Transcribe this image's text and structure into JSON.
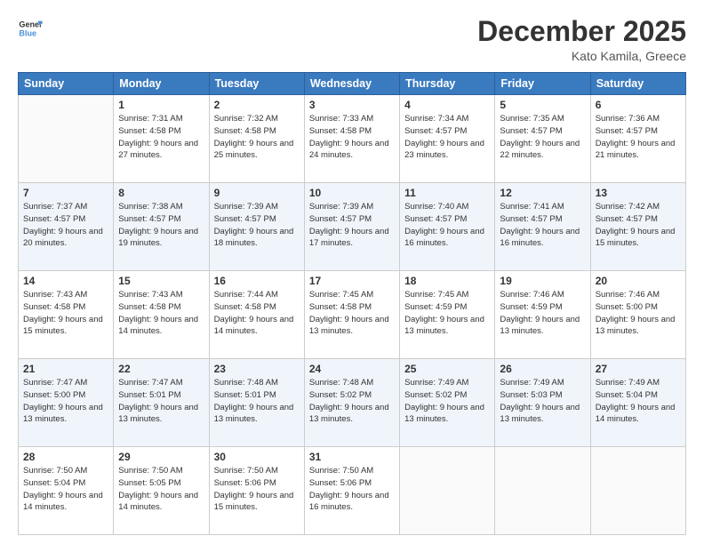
{
  "header": {
    "logo_line1": "General",
    "logo_line2": "Blue",
    "month": "December 2025",
    "location": "Kato Kamila, Greece"
  },
  "weekdays": [
    "Sunday",
    "Monday",
    "Tuesday",
    "Wednesday",
    "Thursday",
    "Friday",
    "Saturday"
  ],
  "weeks": [
    [
      {
        "day": "",
        "sunrise": "",
        "sunset": "",
        "daylight": ""
      },
      {
        "day": "1",
        "sunrise": "Sunrise: 7:31 AM",
        "sunset": "Sunset: 4:58 PM",
        "daylight": "Daylight: 9 hours and 27 minutes."
      },
      {
        "day": "2",
        "sunrise": "Sunrise: 7:32 AM",
        "sunset": "Sunset: 4:58 PM",
        "daylight": "Daylight: 9 hours and 25 minutes."
      },
      {
        "day": "3",
        "sunrise": "Sunrise: 7:33 AM",
        "sunset": "Sunset: 4:58 PM",
        "daylight": "Daylight: 9 hours and 24 minutes."
      },
      {
        "day": "4",
        "sunrise": "Sunrise: 7:34 AM",
        "sunset": "Sunset: 4:57 PM",
        "daylight": "Daylight: 9 hours and 23 minutes."
      },
      {
        "day": "5",
        "sunrise": "Sunrise: 7:35 AM",
        "sunset": "Sunset: 4:57 PM",
        "daylight": "Daylight: 9 hours and 22 minutes."
      },
      {
        "day": "6",
        "sunrise": "Sunrise: 7:36 AM",
        "sunset": "Sunset: 4:57 PM",
        "daylight": "Daylight: 9 hours and 21 minutes."
      }
    ],
    [
      {
        "day": "7",
        "sunrise": "Sunrise: 7:37 AM",
        "sunset": "Sunset: 4:57 PM",
        "daylight": "Daylight: 9 hours and 20 minutes."
      },
      {
        "day": "8",
        "sunrise": "Sunrise: 7:38 AM",
        "sunset": "Sunset: 4:57 PM",
        "daylight": "Daylight: 9 hours and 19 minutes."
      },
      {
        "day": "9",
        "sunrise": "Sunrise: 7:39 AM",
        "sunset": "Sunset: 4:57 PM",
        "daylight": "Daylight: 9 hours and 18 minutes."
      },
      {
        "day": "10",
        "sunrise": "Sunrise: 7:39 AM",
        "sunset": "Sunset: 4:57 PM",
        "daylight": "Daylight: 9 hours and 17 minutes."
      },
      {
        "day": "11",
        "sunrise": "Sunrise: 7:40 AM",
        "sunset": "Sunset: 4:57 PM",
        "daylight": "Daylight: 9 hours and 16 minutes."
      },
      {
        "day": "12",
        "sunrise": "Sunrise: 7:41 AM",
        "sunset": "Sunset: 4:57 PM",
        "daylight": "Daylight: 9 hours and 16 minutes."
      },
      {
        "day": "13",
        "sunrise": "Sunrise: 7:42 AM",
        "sunset": "Sunset: 4:57 PM",
        "daylight": "Daylight: 9 hours and 15 minutes."
      }
    ],
    [
      {
        "day": "14",
        "sunrise": "Sunrise: 7:43 AM",
        "sunset": "Sunset: 4:58 PM",
        "daylight": "Daylight: 9 hours and 15 minutes."
      },
      {
        "day": "15",
        "sunrise": "Sunrise: 7:43 AM",
        "sunset": "Sunset: 4:58 PM",
        "daylight": "Daylight: 9 hours and 14 minutes."
      },
      {
        "day": "16",
        "sunrise": "Sunrise: 7:44 AM",
        "sunset": "Sunset: 4:58 PM",
        "daylight": "Daylight: 9 hours and 14 minutes."
      },
      {
        "day": "17",
        "sunrise": "Sunrise: 7:45 AM",
        "sunset": "Sunset: 4:58 PM",
        "daylight": "Daylight: 9 hours and 13 minutes."
      },
      {
        "day": "18",
        "sunrise": "Sunrise: 7:45 AM",
        "sunset": "Sunset: 4:59 PM",
        "daylight": "Daylight: 9 hours and 13 minutes."
      },
      {
        "day": "19",
        "sunrise": "Sunrise: 7:46 AM",
        "sunset": "Sunset: 4:59 PM",
        "daylight": "Daylight: 9 hours and 13 minutes."
      },
      {
        "day": "20",
        "sunrise": "Sunrise: 7:46 AM",
        "sunset": "Sunset: 5:00 PM",
        "daylight": "Daylight: 9 hours and 13 minutes."
      }
    ],
    [
      {
        "day": "21",
        "sunrise": "Sunrise: 7:47 AM",
        "sunset": "Sunset: 5:00 PM",
        "daylight": "Daylight: 9 hours and 13 minutes."
      },
      {
        "day": "22",
        "sunrise": "Sunrise: 7:47 AM",
        "sunset": "Sunset: 5:01 PM",
        "daylight": "Daylight: 9 hours and 13 minutes."
      },
      {
        "day": "23",
        "sunrise": "Sunrise: 7:48 AM",
        "sunset": "Sunset: 5:01 PM",
        "daylight": "Daylight: 9 hours and 13 minutes."
      },
      {
        "day": "24",
        "sunrise": "Sunrise: 7:48 AM",
        "sunset": "Sunset: 5:02 PM",
        "daylight": "Daylight: 9 hours and 13 minutes."
      },
      {
        "day": "25",
        "sunrise": "Sunrise: 7:49 AM",
        "sunset": "Sunset: 5:02 PM",
        "daylight": "Daylight: 9 hours and 13 minutes."
      },
      {
        "day": "26",
        "sunrise": "Sunrise: 7:49 AM",
        "sunset": "Sunset: 5:03 PM",
        "daylight": "Daylight: 9 hours and 13 minutes."
      },
      {
        "day": "27",
        "sunrise": "Sunrise: 7:49 AM",
        "sunset": "Sunset: 5:04 PM",
        "daylight": "Daylight: 9 hours and 14 minutes."
      }
    ],
    [
      {
        "day": "28",
        "sunrise": "Sunrise: 7:50 AM",
        "sunset": "Sunset: 5:04 PM",
        "daylight": "Daylight: 9 hours and 14 minutes."
      },
      {
        "day": "29",
        "sunrise": "Sunrise: 7:50 AM",
        "sunset": "Sunset: 5:05 PM",
        "daylight": "Daylight: 9 hours and 14 minutes."
      },
      {
        "day": "30",
        "sunrise": "Sunrise: 7:50 AM",
        "sunset": "Sunset: 5:06 PM",
        "daylight": "Daylight: 9 hours and 15 minutes."
      },
      {
        "day": "31",
        "sunrise": "Sunrise: 7:50 AM",
        "sunset": "Sunset: 5:06 PM",
        "daylight": "Daylight: 9 hours and 16 minutes."
      },
      {
        "day": "",
        "sunrise": "",
        "sunset": "",
        "daylight": ""
      },
      {
        "day": "",
        "sunrise": "",
        "sunset": "",
        "daylight": ""
      },
      {
        "day": "",
        "sunrise": "",
        "sunset": "",
        "daylight": ""
      }
    ]
  ]
}
